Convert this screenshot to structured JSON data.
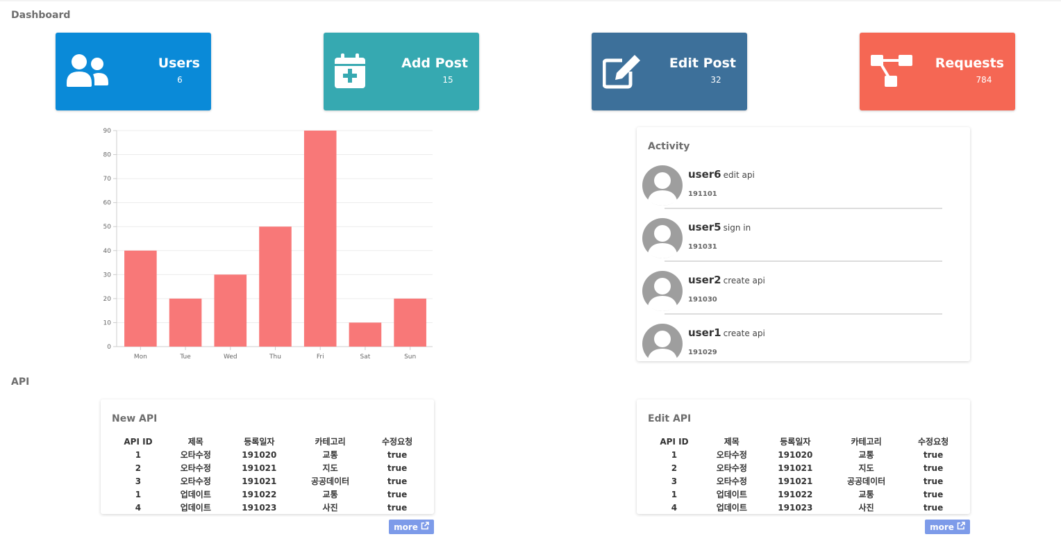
{
  "header": {
    "title": "Dashboard"
  },
  "cards": [
    {
      "title": "Users",
      "count": "6",
      "color": "#0a8ad8",
      "icon": "users-icon"
    },
    {
      "title": "Add Post",
      "count": "15",
      "color": "#36a9b1",
      "icon": "calendar-plus-icon"
    },
    {
      "title": "Edit Post",
      "count": "32",
      "color": "#3d709a",
      "icon": "edit-icon"
    },
    {
      "title": "Requests",
      "count": "784",
      "color": "#f56754",
      "icon": "sitemap-icon"
    }
  ],
  "chart_data": {
    "type": "bar",
    "categories": [
      "Mon",
      "Tue",
      "Wed",
      "Thu",
      "Fri",
      "Sat",
      "Sun"
    ],
    "values": [
      40,
      20,
      30,
      50,
      90,
      10,
      20
    ],
    "ylim": [
      0,
      90
    ],
    "yticks": [
      0,
      10,
      20,
      30,
      40,
      50,
      60,
      70,
      80,
      90
    ],
    "bar_color": "#f87878",
    "grid": true
  },
  "activity": {
    "title": "Activity",
    "items": [
      {
        "user": "user6",
        "action": "edit api",
        "date": "191101"
      },
      {
        "user": "user5",
        "action": "sign in",
        "date": "191031"
      },
      {
        "user": "user2",
        "action": "create api",
        "date": "191030"
      },
      {
        "user": "user1",
        "action": "create api",
        "date": "191029"
      }
    ]
  },
  "api_section": {
    "title": "API"
  },
  "tables": [
    {
      "title": "New API",
      "headers": [
        "API ID",
        "제목",
        "등록일자",
        "카테고리",
        "수정요청"
      ],
      "rows": [
        [
          "1",
          "오타수정",
          "191020",
          "교통",
          "true"
        ],
        [
          "2",
          "오타수정",
          "191021",
          "지도",
          "true"
        ],
        [
          "3",
          "오타수정",
          "191021",
          "공공데이터",
          "true"
        ],
        [
          "1",
          "업데이트",
          "191022",
          "교통",
          "true"
        ],
        [
          "4",
          "업데이트",
          "191023",
          "사진",
          "true"
        ]
      ],
      "more_label": "more"
    },
    {
      "title": "Edit API",
      "headers": [
        "API ID",
        "제목",
        "등록일자",
        "카테고리",
        "수정요청"
      ],
      "rows": [
        [
          "1",
          "오타수정",
          "191020",
          "교통",
          "true"
        ],
        [
          "2",
          "오타수정",
          "191021",
          "지도",
          "true"
        ],
        [
          "3",
          "오타수정",
          "191021",
          "공공데이터",
          "true"
        ],
        [
          "1",
          "업데이트",
          "191022",
          "교통",
          "true"
        ],
        [
          "4",
          "업데이트",
          "191023",
          "사진",
          "true"
        ]
      ],
      "more_label": "more"
    }
  ]
}
